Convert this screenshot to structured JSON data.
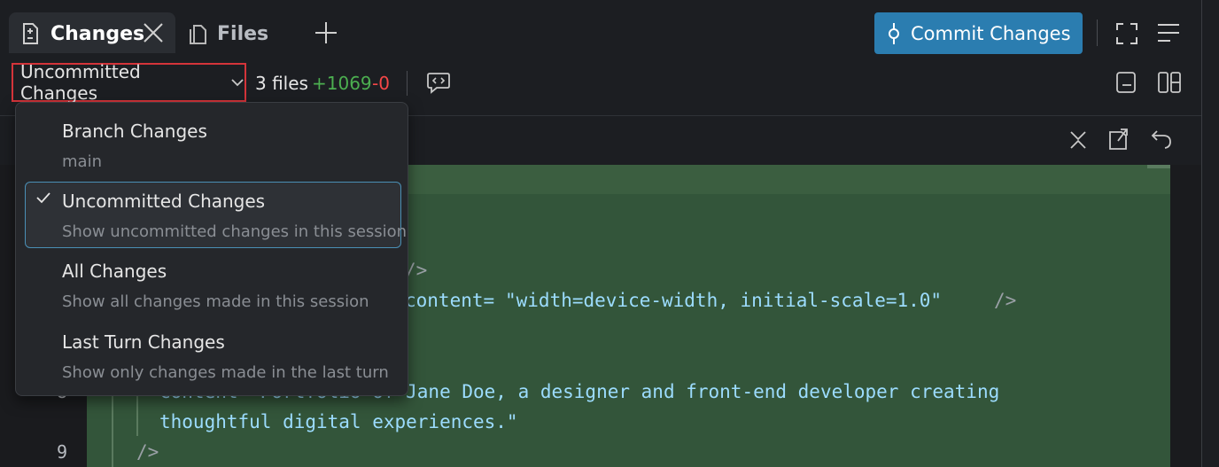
{
  "tabs": [
    {
      "label": "Changes",
      "icon": "changes-doc-icon",
      "active": true
    },
    {
      "label": "Files",
      "icon": "files-icon",
      "active": false
    }
  ],
  "toolbar": {
    "commit_label": "Commit Changes"
  },
  "selector": {
    "label": "Uncommitted Changes"
  },
  "stats": {
    "files": "3 files",
    "added": "+1069",
    "removed": "-0"
  },
  "dropdown": {
    "options": [
      {
        "title": "Branch Changes",
        "subtitle": "main",
        "selected": false
      },
      {
        "title": "Uncommitted Changes",
        "subtitle": "Show uncommitted changes in this session",
        "selected": true
      },
      {
        "title": "All Changes",
        "subtitle": "Show all changes made in this session",
        "selected": false
      },
      {
        "title": "Last Turn Changes",
        "subtitle": "Show only changes made in the last turn",
        "selected": false
      }
    ]
  },
  "code": {
    "line1_tail": "/>",
    "line2_attr": "content=",
    "line2_value": "\"width=device-width, initial-scale=1.0\"",
    "line2_close": "/>",
    "line3_num": "8",
    "line3_text": "content=\"Portfolio of Jane Doe, a designer and front-end developer creating",
    "line4_text": "thoughtful digital experiences.\"",
    "line5_num": "9",
    "line5_text": "/>"
  },
  "colors": {
    "accent": "#2b7db0",
    "added": "#4caf50",
    "removed": "#f44747",
    "diff_bg": "#33553a",
    "highlight_border": "#d4343a"
  }
}
